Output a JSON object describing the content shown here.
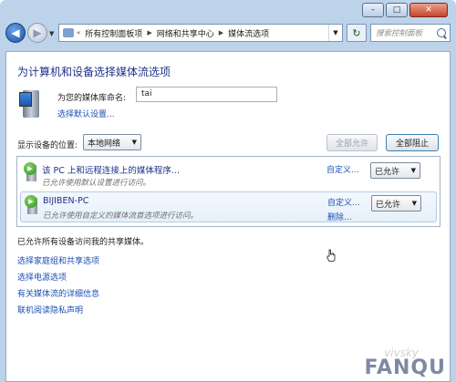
{
  "window": {
    "controls": {
      "minimize": "–",
      "maximize": "□",
      "close": "✕"
    }
  },
  "nav": {
    "back": "◀",
    "forward": "▶",
    "breadcrumb": [
      "«",
      "所有控制面板项",
      "网络和共享中心",
      "媒体流选项"
    ],
    "search_placeholder": "搜索控制面板"
  },
  "page": {
    "title": "为计算机和设备选择媒体流选项",
    "library_label": "为您的媒体库命名:",
    "library_value": "tai",
    "defaults_link": "选择默认设置...",
    "show_devices_label": "显示设备的位置:",
    "network_selected": "本地网络",
    "allow_all": "全部允许",
    "block_all": "全部阻止"
  },
  "devices": [
    {
      "name": "该 PC 上和远程连接上的媒体程序...",
      "description": "已允许使用默认设置进行访问。",
      "custom": "自定义...",
      "remove": "",
      "status": "已允许"
    },
    {
      "name": "BIJIBEN-PC",
      "description": "已允许使用自定义的媒体流首选项进行访问。",
      "custom": "自定义...",
      "remove": "删除...",
      "status": "已允许"
    }
  ],
  "summary": "已允许所有设备访问我的共享媒体。",
  "links": [
    "选择家庭组和共享选项",
    "选择电源选项",
    "有关媒体流的详细信息",
    "联机阅读隐私声明"
  ],
  "watermark": "FANQU",
  "watermark_small": "vivsky"
}
